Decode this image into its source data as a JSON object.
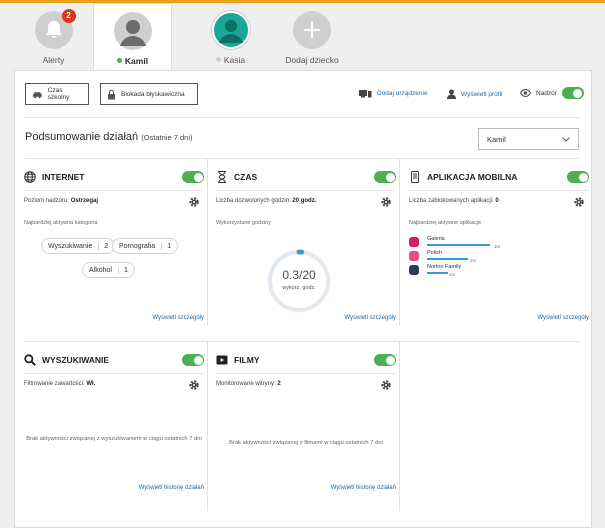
{
  "tabs": [
    {
      "label": "Alerty",
      "badge": "2"
    },
    {
      "label": "Kamil",
      "status_color": "#4caf50"
    },
    {
      "label": "Kasia",
      "status_color": "#cfcfcf"
    },
    {
      "label": "Dodaj dziecko"
    }
  ],
  "toolbar": {
    "school_time": "Czas szkolny",
    "instant_lock": "Blokada błyskawiczna",
    "add_device": "Dodaj urządzenie",
    "view_profile": "Wyświetl profil",
    "supervision": "Nadzór"
  },
  "summary": {
    "title": "Podsumowanie działań",
    "period": "(Ostatnie 7 dni)",
    "child_select": "Kamil"
  },
  "cards": {
    "internet": {
      "title": "INTERNET",
      "level_label": "Poziom nadzoru:",
      "level_value": "Ostrzegaj",
      "top_category_label": "Najbardziej aktywna kategoria",
      "categories": [
        {
          "name": "Wyszukiwanie",
          "count": "2"
        },
        {
          "name": "Pornografia",
          "count": "1"
        },
        {
          "name": "Alkohol",
          "count": "1"
        }
      ],
      "link": "Wyświetl szczegóły"
    },
    "time": {
      "title": "CZAS",
      "allowed_label": "Liczba dozwolonych godzin:",
      "allowed_value": "20 godz.",
      "used_label": "Wykorzystane godziny",
      "used_value": "0.3/20",
      "used_fraction": 0.015,
      "used_unit": "wykorz. godz.",
      "link": "Wyświetl szczegóły"
    },
    "mobile": {
      "title": "APLIKACJA MOBILNA",
      "blocked_label": "Liczba zablokowanych aplikacji:",
      "blocked_value": "0",
      "top_apps_label": "Najbardziej aktywne aplikacje",
      "apps": [
        {
          "name": "Galeria",
          "time": "3m",
          "fraction": 0.95,
          "color": "#d81b60"
        },
        {
          "name": "Polish",
          "time": "2m",
          "fraction": 0.62,
          "color": "#e04e8a"
        },
        {
          "name": "Norton Family",
          "time": "1m",
          "fraction": 0.32,
          "color": "#2e3b55"
        }
      ],
      "link": "Wyświetl szczegóły"
    },
    "search": {
      "title": "WYSZUKIWANIE",
      "filter_label": "Filtrowanie zawartości:",
      "filter_value": "Wł.",
      "empty": "Brak aktywności związanej z wyszukiwaniem w ciągu ostatnich 7 dni",
      "link": "Wyświetl historię działań"
    },
    "videos": {
      "title": "FILMY",
      "monitored_label": "Monitorowane witryny:",
      "monitored_value": "2",
      "empty": "Brak aktywności związanej z filmami w ciągu ostatnich 7 dni",
      "link": "Wyświetl historię działań"
    }
  },
  "colors": {
    "accent": "#e6a118",
    "toggle_on": "#4caf50",
    "link": "#1f6aa5",
    "alert": "#d6391f"
  }
}
